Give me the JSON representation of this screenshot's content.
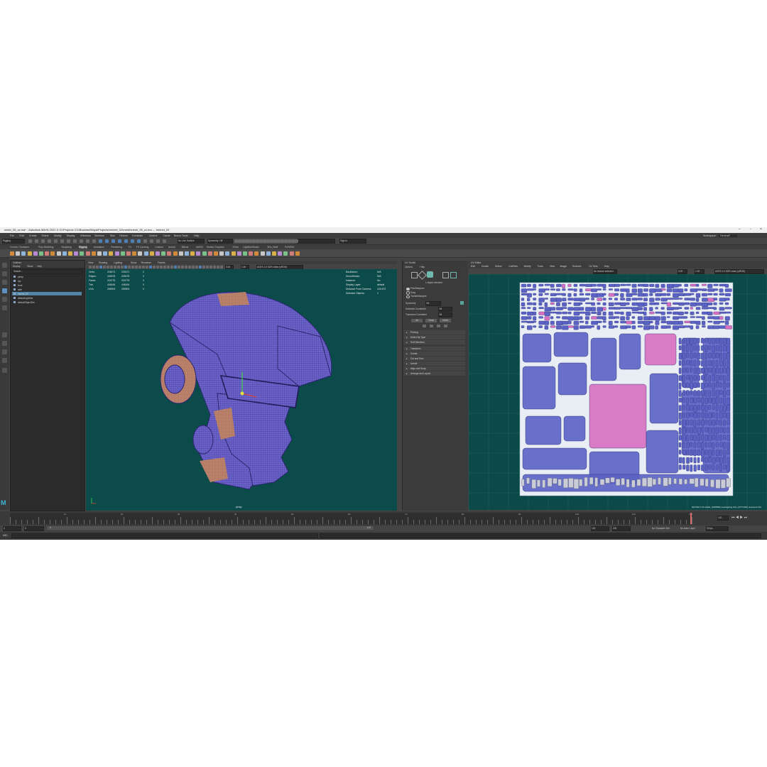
{
  "window": {
    "title": "mesh_05_uv.ma* - Autodesk MAYA 2022.3: D:\\Projects CG\\Busines\\Maya\\Projects\\helmet_02\\mesh\\mesh_05_uv.ma  ---  helmet_02",
    "workspace_label": "Workspace:",
    "workspace_value": "General*"
  },
  "menubar": [
    "File",
    "Edit",
    "Create",
    "Select",
    "Modify",
    "Display",
    "Windows",
    "Skeleton",
    "Skin",
    "Deform",
    "Constrain",
    "Control",
    "Cache",
    "Bonus Tools",
    "Help"
  ],
  "toolbar": {
    "mode_select": "Rigging",
    "live_surface": "No Live Surface",
    "symmetry": "Symmetry: Off",
    "sign_in": "Sign In"
  },
  "shelf_tabs": [
    "Curves / Surfaces",
    "Poly Modeling",
    "Sculpting",
    "Rigging",
    "Animation",
    "Rendering",
    "FX",
    "FX Caching",
    "Custom",
    "Arnold",
    "Bifrost",
    "MASH",
    "Motion Graphics",
    "XGen",
    "LightBoxStudio",
    "3Ds_Stuff",
    "FUNSSK"
  ],
  "outliner": {
    "title": "Outliner",
    "menus": [
      "Display",
      "Show",
      "Help"
    ],
    "search_placeholder": "Search...",
    "items": [
      {
        "label": "persp"
      },
      {
        "label": "top"
      },
      {
        "label": "front"
      },
      {
        "label": "side"
      },
      {
        "label": "helmet_02",
        "selected": true
      },
      {
        "label": "defaultLightSet"
      },
      {
        "label": "defaultObjectSet"
      }
    ]
  },
  "viewport": {
    "menus": [
      "View",
      "Shading",
      "Lighting",
      "Show",
      "Renderer",
      "Panels"
    ],
    "hud_stats": {
      "rows": [
        {
          "label": "Verts:",
          "a": "226471",
          "b": "226471",
          "c": "0"
        },
        {
          "label": "Edges:",
          "a": "449478",
          "b": "449478",
          "c": "0"
        },
        {
          "label": "Faces:",
          "a": "224776",
          "b": "224776",
          "c": "0"
        },
        {
          "label": "Tris:",
          "a": "446164",
          "b": "446164",
          "c": "0"
        },
        {
          "label": "UVs:",
          "a": "265903",
          "b": "265903",
          "c": "0"
        }
      ]
    },
    "hud_right": [
      {
        "label": "Backfaces:",
        "value": "N/A"
      },
      {
        "label": "Smoothness:",
        "value": "N/A"
      },
      {
        "label": "Instance:",
        "value": "No"
      },
      {
        "label": "Display Layer:",
        "value": "default"
      },
      {
        "label": "Distance From Camera:",
        "value": "240.672"
      },
      {
        "label": "Selected Objects:",
        "value": "1"
      }
    ],
    "camera_label": "persp",
    "colorspace": "ACES 1.0 SDR-video (sRGB)",
    "val1": "0.00",
    "val2": "1.00",
    "mesh_color": "#6b63c9",
    "accent_color": "#c98a72",
    "bg_color": "#0b4b4a"
  },
  "uv_toolkit": {
    "title": "UV Toolkit",
    "menus": [
      "Options",
      "Help"
    ],
    "selected_label": "1 object selected",
    "options": [
      "Pick/Marquee",
      "Drag",
      "Tweak/Marquee"
    ],
    "symmetry_label": "Symmetry",
    "symmetry_value": "Off",
    "selection_constraint_label": "Selection Constraint",
    "selection_constraint_value": "Off",
    "transform_constraint_label": "Transform Constraint",
    "transform_constraint_value": "Off",
    "buttons": [
      "All",
      "Clear",
      "Invert"
    ],
    "sections_a": [
      "Pinning",
      "Select By Type",
      "Soft Selection"
    ],
    "sections_b": [
      "Transform",
      "Create",
      "Cut and Sew",
      "Unfold",
      "Align and Snap",
      "Arrange and Layout"
    ]
  },
  "uv_editor": {
    "title": "UV Editor",
    "menus": [
      "Edit",
      "Create",
      "Select",
      "Cut/Sew",
      "Modify",
      "Tools",
      "View",
      "Image",
      "Textures",
      "UV Sets",
      "Help"
    ],
    "texture_label": "No texture selected",
    "colorspace": "ACES 1.0 SDR-video (sRGB)",
    "val1": "0.00",
    "val2": "1.00",
    "status": "(817/927) UV shells, (0/26595) overlapping UVs, (0/771/93) reversed UVs",
    "bg_color": "#0c4a49",
    "shell_fill": "#5a62c4",
    "highlight": "#d86fc0"
  },
  "timeline": {
    "ticks": [
      "10",
      "20",
      "30",
      "40",
      "50",
      "60",
      "70",
      "80",
      "90",
      "100",
      "110",
      "120"
    ],
    "current_frame": "120"
  },
  "range": {
    "start": "0",
    "start2": "0",
    "range_start": "0",
    "range_end": "120",
    "end": "120",
    "end2": "200",
    "fps": "30 fps",
    "no_character": "No Character Set",
    "no_anim_layer": "No Anim Layer"
  },
  "cmdline": {
    "label": "MEL"
  }
}
